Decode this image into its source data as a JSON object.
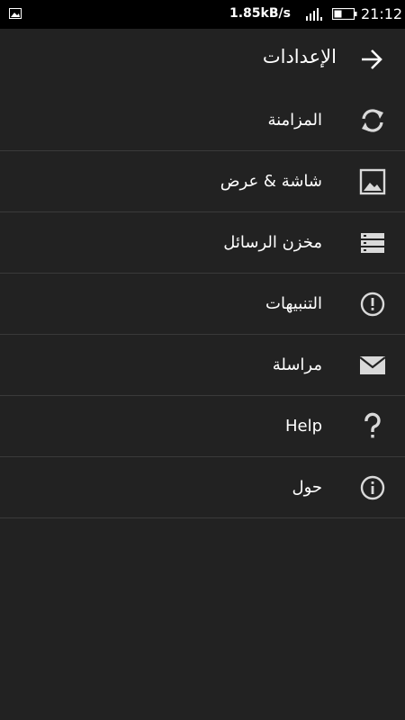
{
  "status_bar": {
    "speed": "1.85kB/s",
    "time": "21:12",
    "icons": [
      "image-notification-icon",
      "network-signal-icon",
      "battery-icon"
    ]
  },
  "header": {
    "title": "الإعدادات",
    "back_icon": "arrow-right-icon"
  },
  "menu": {
    "items": [
      {
        "label": "المزامنة",
        "icon": "sync-icon"
      },
      {
        "label": "شاشة & عرض",
        "icon": "image-icon"
      },
      {
        "label": "مخزن الرسائل",
        "icon": "storage-icon"
      },
      {
        "label": "التنبيهات",
        "icon": "alert-icon"
      },
      {
        "label": "مراسلة",
        "icon": "mail-icon"
      },
      {
        "label": "Help",
        "icon": "help-icon"
      },
      {
        "label": "حول",
        "icon": "info-icon"
      }
    ]
  }
}
